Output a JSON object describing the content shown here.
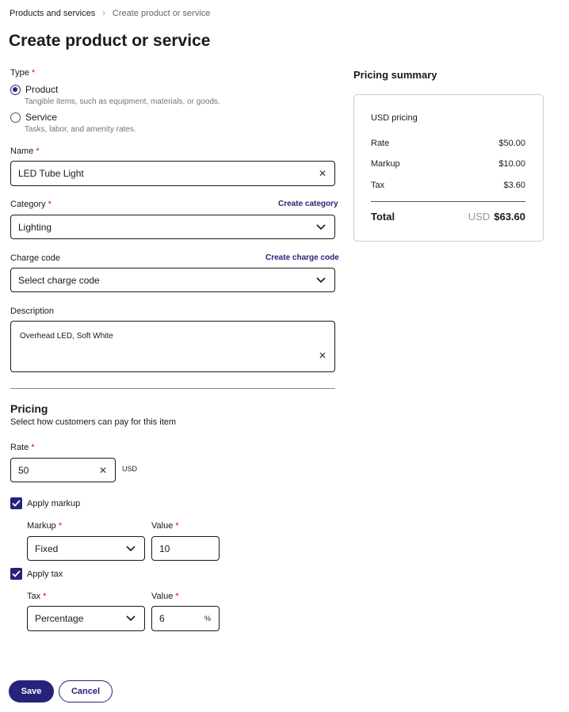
{
  "breadcrumb": {
    "parent": "Products and services",
    "current": "Create product or service"
  },
  "page_title": "Create product or service",
  "type": {
    "label": "Type",
    "options": [
      {
        "label": "Product",
        "hint": "Tangible items, such as equipment, materials, or goods.",
        "selected": true
      },
      {
        "label": "Service",
        "hint": "Tasks, labor, and amenity rates.",
        "selected": false
      }
    ]
  },
  "name": {
    "label": "Name",
    "value": "LED Tube Light"
  },
  "category": {
    "label": "Category",
    "value": "Lighting",
    "create_link": "Create category"
  },
  "charge_code": {
    "label": "Charge code",
    "placeholder": "Select charge code",
    "create_link": "Create charge code"
  },
  "description": {
    "label": "Description",
    "value": "Overhead LED, Soft White"
  },
  "pricing": {
    "title": "Pricing",
    "subtitle": "Select how customers can pay for this item",
    "rate_label": "Rate",
    "rate_value": "50",
    "currency": "USD",
    "apply_markup_label": "Apply markup",
    "apply_markup_checked": true,
    "markup_label": "Markup",
    "markup_type": "Fixed",
    "markup_value_label": "Value",
    "markup_value": "10",
    "apply_tax_label": "Apply tax",
    "apply_tax_checked": true,
    "tax_label": "Tax",
    "tax_type": "Percentage",
    "tax_value_label": "Value",
    "tax_value": "6",
    "tax_unit": "%"
  },
  "summary": {
    "title": "Pricing summary",
    "currency_heading": "USD pricing",
    "rows": [
      {
        "label": "Rate",
        "value": "$50.00"
      },
      {
        "label": "Markup",
        "value": "$10.00"
      },
      {
        "label": "Tax",
        "value": "$3.60"
      }
    ],
    "total_label": "Total",
    "total_currency": "USD",
    "total_value": "$63.60"
  },
  "actions": {
    "save": "Save",
    "cancel": "Cancel"
  },
  "colors": {
    "accent": "#27237a",
    "required": "#c8102e",
    "border": "#1a1a1a",
    "muted": "#757575"
  }
}
